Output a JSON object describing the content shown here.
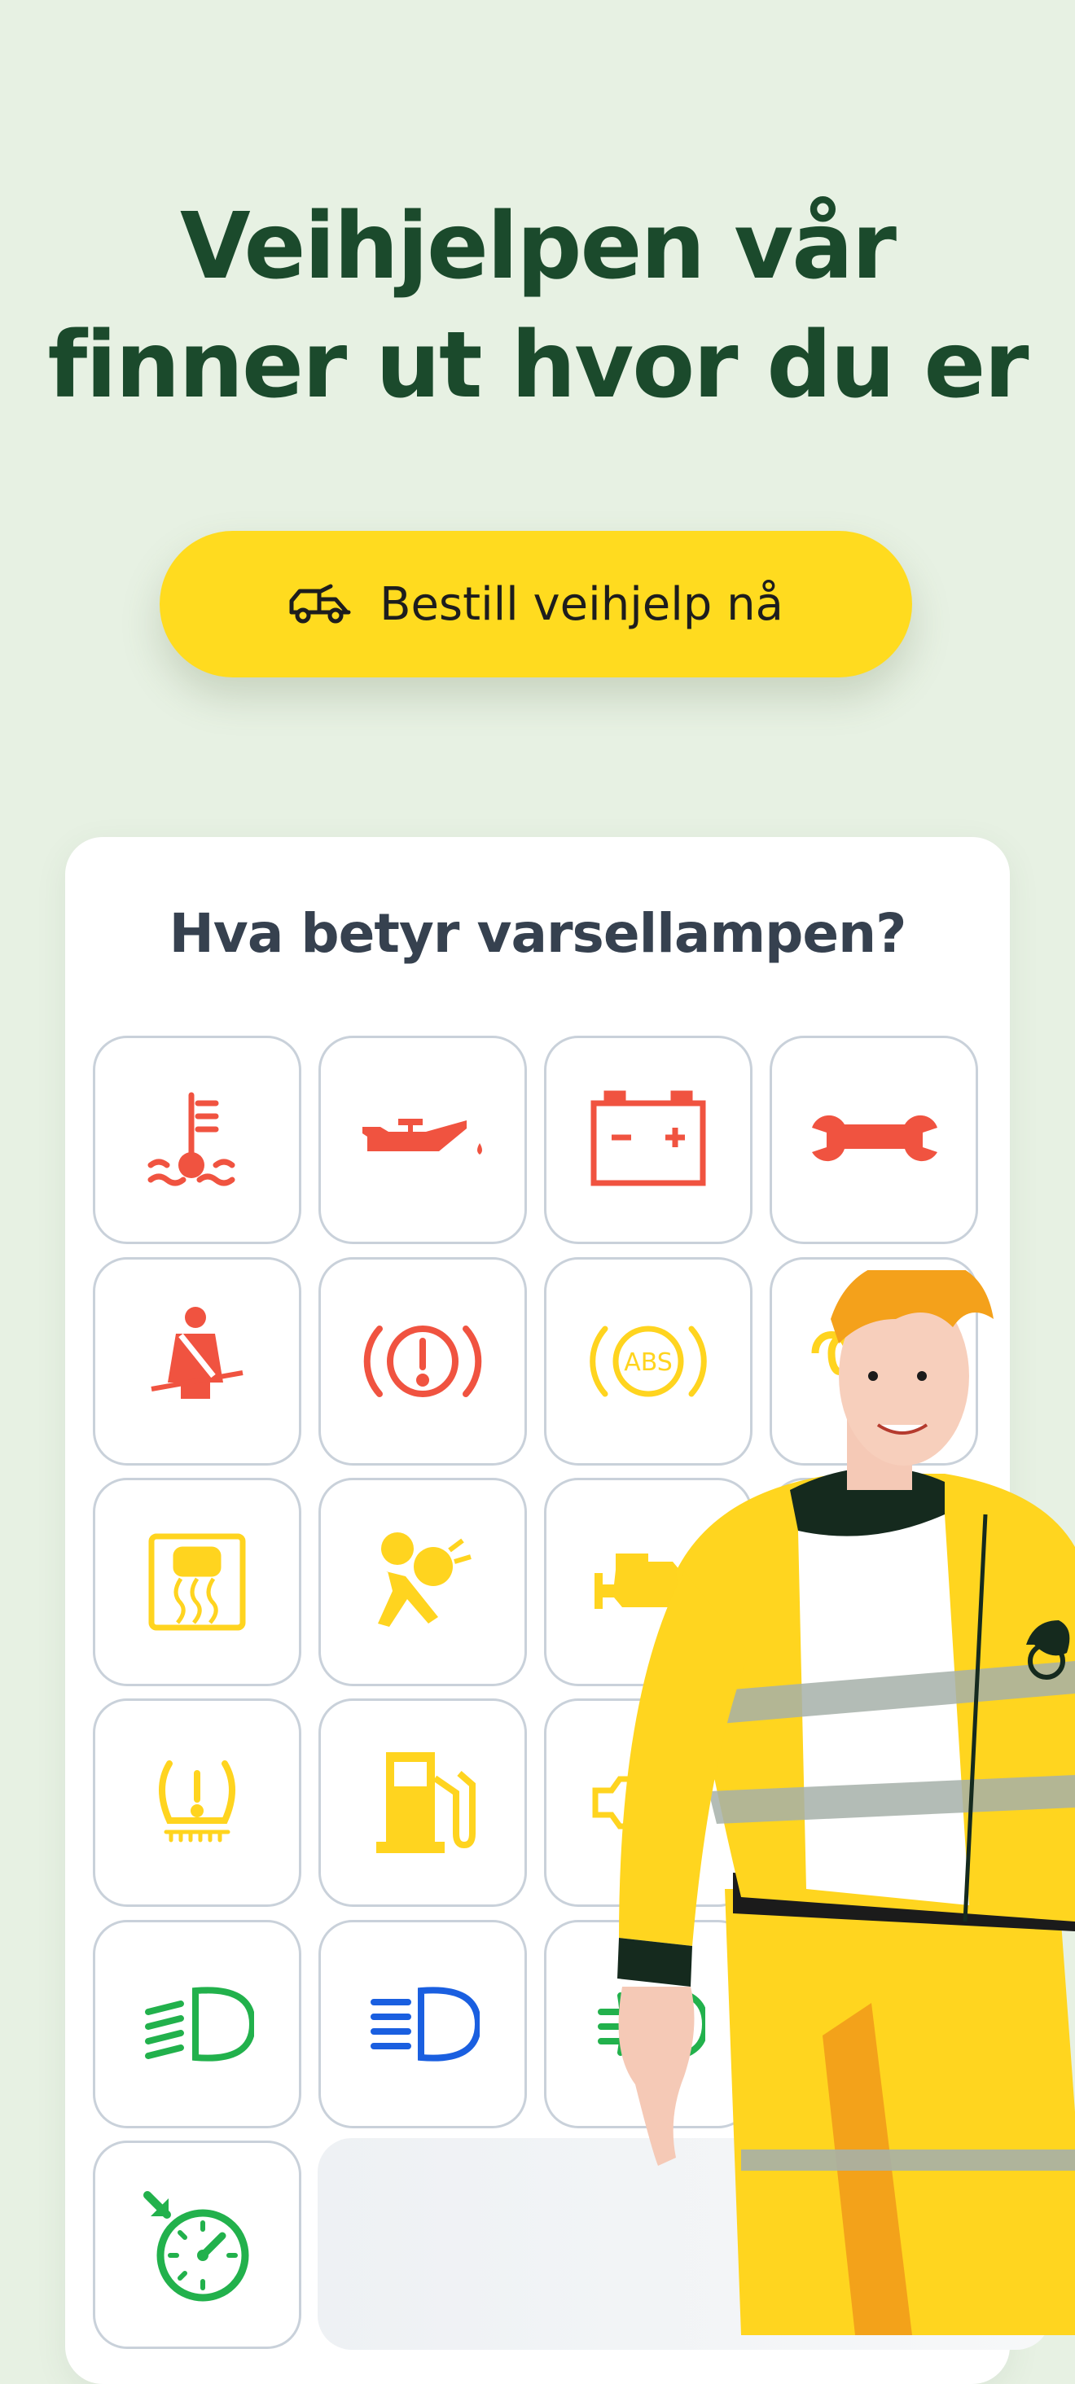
{
  "header": {
    "title_line1": "Veihjelpen vår",
    "title_line2": "finner ut hvor du er"
  },
  "cta": {
    "label": "Bestill veihjelp nå",
    "icon": "tow-truck-icon"
  },
  "warning_lights": {
    "title": "Hva betyr varsellampen?",
    "items": [
      {
        "icon": "coolant-temperature-icon",
        "color": "#f05340"
      },
      {
        "icon": "oil-pressure-icon",
        "color": "#f05340"
      },
      {
        "icon": "battery-icon",
        "color": "#f05340"
      },
      {
        "icon": "service-wrench-icon",
        "color": "#f05340"
      },
      {
        "icon": "seatbelt-icon",
        "color": "#f05340"
      },
      {
        "icon": "brake-warning-icon",
        "color": "#f05340"
      },
      {
        "icon": "abs-icon",
        "color": "#ffd41f",
        "text": "ABS"
      },
      {
        "icon": "glow-plug-icon",
        "color": "#ffd41f"
      },
      {
        "icon": "traction-control-icon",
        "color": "#ffd41f"
      },
      {
        "icon": "airbag-icon",
        "color": "#ffd41f"
      },
      {
        "icon": "check-engine-icon",
        "color": "#ffd41f"
      },
      {
        "icon": "tire-pressure-icon",
        "color": "#ffd41f"
      },
      {
        "icon": "fuel-icon",
        "color": "#ffd41f"
      },
      {
        "icon": "particulate-filter-icon",
        "color": "#ffd41f"
      },
      {
        "icon": "low-beam-icon",
        "color": "#22b14c"
      },
      {
        "icon": "high-beam-icon",
        "color": "#1a5fe0"
      },
      {
        "icon": "fog-light-icon",
        "color": "#22b14c"
      },
      {
        "icon": "cruise-control-icon",
        "color": "#22b14c"
      }
    ]
  },
  "colors": {
    "background": "#e7f1e3",
    "headline": "#1b4a2c",
    "cta": "#ffdb1f",
    "red": "#f05340",
    "yellow": "#ffd41f",
    "green": "#22b14c",
    "blue": "#1a5fe0"
  },
  "mascot": {
    "icon": "roadside-assistant-illustration"
  }
}
